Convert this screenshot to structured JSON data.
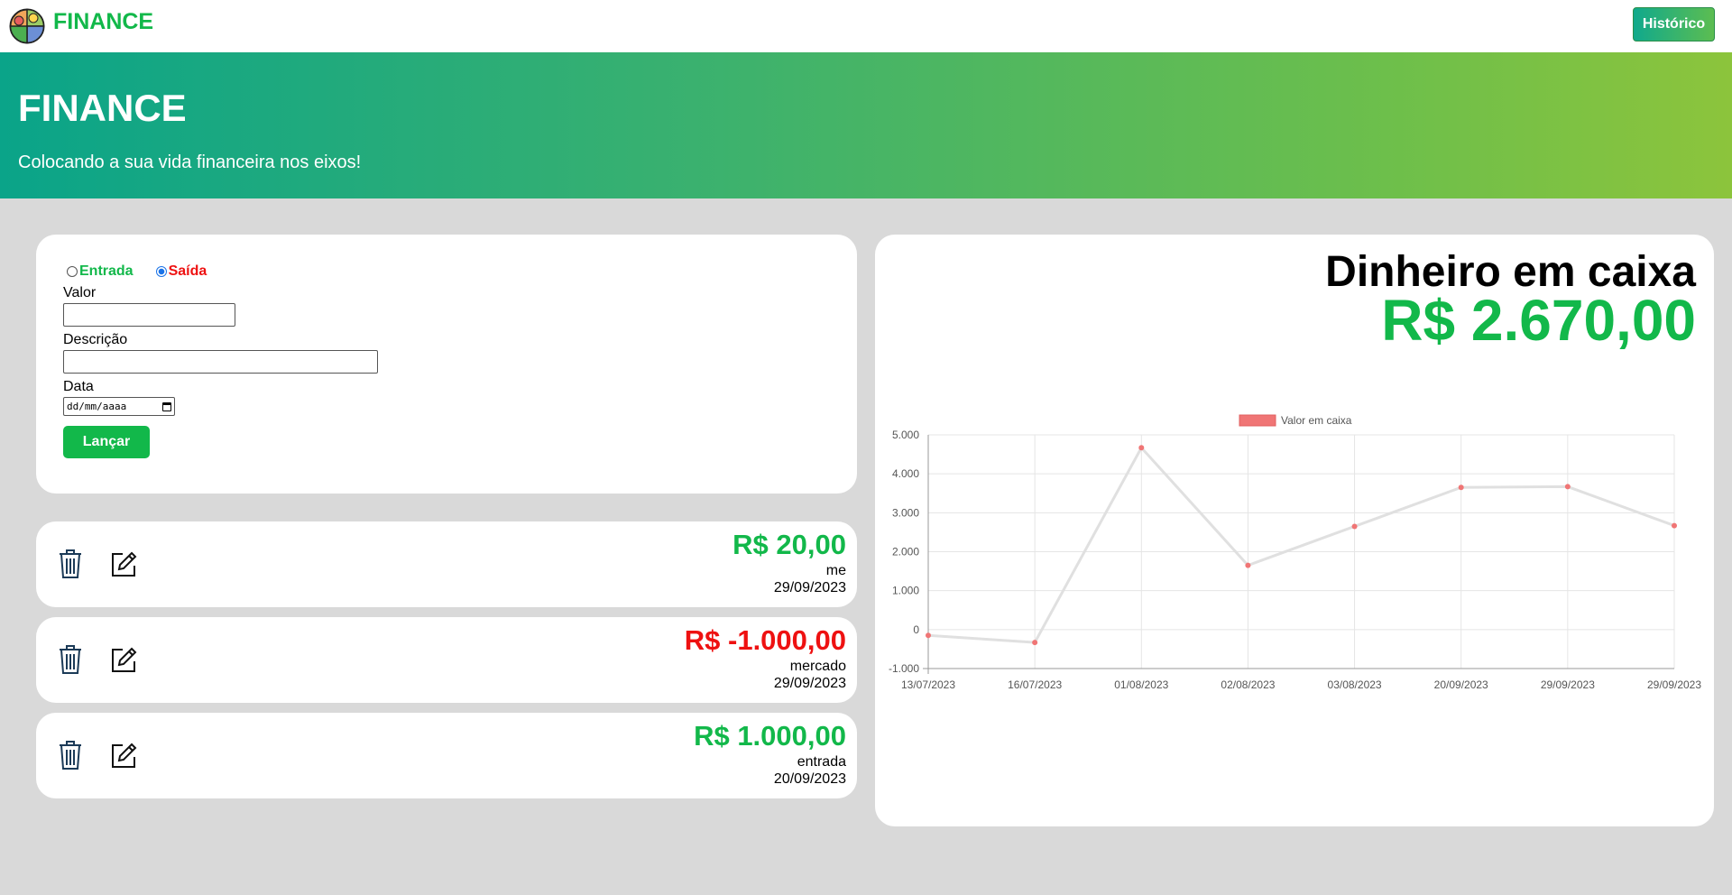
{
  "navbar": {
    "brand": "FINANCE",
    "history_button": "Histórico"
  },
  "hero": {
    "title": "FINANCE",
    "subtitle": "Colocando a sua vida financeira nos eixos!"
  },
  "form": {
    "radio_entrada": "Entrada",
    "radio_saida": "Saída",
    "selected": "Saída",
    "valor_label": "Valor",
    "valor_value": "",
    "descricao_label": "Descrição",
    "descricao_value": "",
    "data_label": "Data",
    "data_placeholder": "dd/mm/aaaa",
    "submit": "Lançar"
  },
  "transactions": [
    {
      "amount": "R$ 20,00",
      "description": "me",
      "date": "29/09/2023",
      "type": "entrada"
    },
    {
      "amount": "R$ -1.000,00",
      "description": "mercado",
      "date": "29/09/2023",
      "type": "saida"
    },
    {
      "amount": "R$ 1.000,00",
      "description": "entrada",
      "date": "20/09/2023",
      "type": "entrada"
    }
  ],
  "cash": {
    "title": "Dinheiro em caixa",
    "value": "R$ 2.670,00"
  },
  "colors": {
    "positive": "#12b84a",
    "negative": "#ee1111",
    "point": "#f07575",
    "line": "#e0e0e0"
  },
  "icons": [
    "logo-icon",
    "trash-icon",
    "edit-icon",
    "calendar-icon"
  ],
  "chart_data": {
    "type": "line",
    "legend": [
      "Valor em caixa"
    ],
    "legend_position": "top",
    "categories": [
      "13/07/2023",
      "16/07/2023",
      "01/08/2023",
      "02/08/2023",
      "03/08/2023",
      "20/09/2023",
      "29/09/2023",
      "29/09/2023"
    ],
    "series": [
      {
        "name": "Valor em caixa",
        "values": [
          -150,
          -330,
          4670,
          1650,
          2650,
          3650,
          3670,
          2670
        ]
      }
    ],
    "y_ticks": [
      "5.000",
      "4.000",
      "3.000",
      "2.000",
      "1.000",
      "0",
      "-1.000"
    ],
    "ylim": [
      -1000,
      5000
    ],
    "grid": true
  }
}
